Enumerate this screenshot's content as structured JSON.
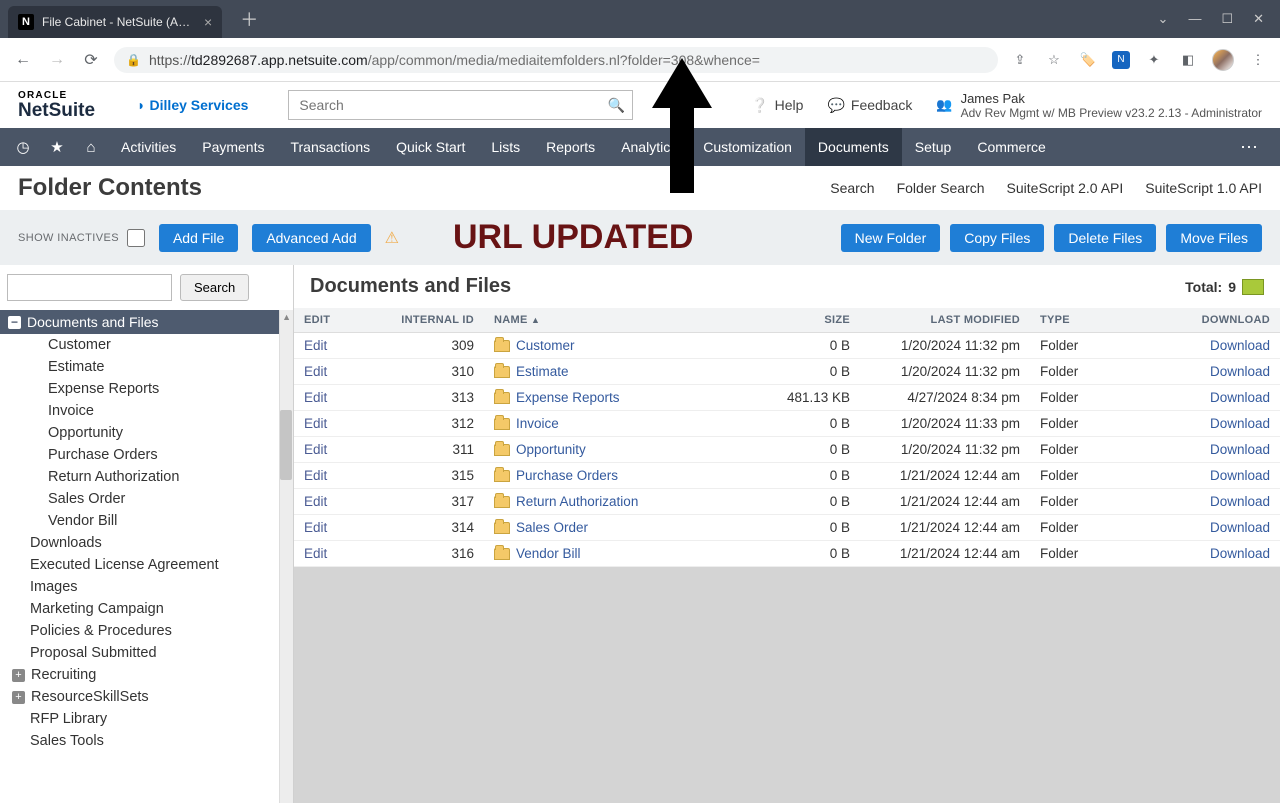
{
  "browser": {
    "tab_title": "File Cabinet - NetSuite (Adv Rev",
    "url_domain": "td2892687.app.netsuite.com",
    "url_path": "/app/common/media/mediaitemfolders.nl?folder=308&whence=",
    "url_prefix": "https://"
  },
  "topbar": {
    "brand_sub": "Dilley Services",
    "search_placeholder": "Search",
    "help": "Help",
    "feedback": "Feedback",
    "user_name": "James Pak",
    "user_role": "Adv Rev Mgmt w/ MB Preview v23.2 2.13  -  Administrator"
  },
  "nav": {
    "items": [
      "Activities",
      "Payments",
      "Transactions",
      "Quick Start",
      "Lists",
      "Reports",
      "Analytics",
      "Customization",
      "Documents",
      "Setup",
      "Commerce"
    ],
    "active": "Documents"
  },
  "page": {
    "title": "Folder Contents",
    "links": [
      "Search",
      "Folder Search",
      "SuiteScript 2.0 API",
      "SuiteScript 1.0 API"
    ]
  },
  "actions": {
    "show_inactives": "SHOW INACTIVES",
    "add_file": "Add File",
    "advanced_add": "Advanced Add",
    "url_updated": "URL UPDATED",
    "new_folder": "New Folder",
    "copy_files": "Copy Files",
    "delete_files": "Delete Files",
    "move_files": "Move Files"
  },
  "left": {
    "search_btn": "Search",
    "root": "Documents and Files",
    "children": [
      "Customer",
      "Estimate",
      "Expense Reports",
      "Invoice",
      "Opportunity",
      "Purchase Orders",
      "Return Authorization",
      "Sales Order",
      "Vendor Bill"
    ],
    "top_level": [
      {
        "label": "Downloads",
        "expand": false
      },
      {
        "label": "Executed License Agreement",
        "expand": false
      },
      {
        "label": "Images",
        "expand": false
      },
      {
        "label": "Marketing Campaign",
        "expand": false
      },
      {
        "label": "Policies & Procedures",
        "expand": false
      },
      {
        "label": "Proposal Submitted",
        "expand": false
      },
      {
        "label": "Recruiting",
        "expand": true
      },
      {
        "label": "ResourceSkillSets",
        "expand": true
      },
      {
        "label": "RFP Library",
        "expand": false
      },
      {
        "label": "Sales Tools",
        "expand": false
      }
    ]
  },
  "table": {
    "heading": "Documents and Files",
    "total_label": "Total:",
    "total_count": "9",
    "cols": {
      "edit": "EDIT",
      "id": "INTERNAL ID",
      "name": "NAME",
      "size": "SIZE",
      "modified": "LAST MODIFIED",
      "type": "TYPE",
      "download": "DOWNLOAD"
    },
    "edit_text": "Edit",
    "download_text": "Download",
    "rows": [
      {
        "id": "309",
        "name": "Customer",
        "size": "0 B",
        "modified": "1/20/2024 11:32 pm",
        "type": "Folder"
      },
      {
        "id": "310",
        "name": "Estimate",
        "size": "0 B",
        "modified": "1/20/2024 11:32 pm",
        "type": "Folder"
      },
      {
        "id": "313",
        "name": "Expense Reports",
        "size": "481.13 KB",
        "modified": "4/27/2024 8:34 pm",
        "type": "Folder"
      },
      {
        "id": "312",
        "name": "Invoice",
        "size": "0 B",
        "modified": "1/20/2024 11:33 pm",
        "type": "Folder"
      },
      {
        "id": "311",
        "name": "Opportunity",
        "size": "0 B",
        "modified": "1/20/2024 11:32 pm",
        "type": "Folder"
      },
      {
        "id": "315",
        "name": "Purchase Orders",
        "size": "0 B",
        "modified": "1/21/2024 12:44 am",
        "type": "Folder"
      },
      {
        "id": "317",
        "name": "Return Authorization",
        "size": "0 B",
        "modified": "1/21/2024 12:44 am",
        "type": "Folder"
      },
      {
        "id": "314",
        "name": "Sales Order",
        "size": "0 B",
        "modified": "1/21/2024 12:44 am",
        "type": "Folder"
      },
      {
        "id": "316",
        "name": "Vendor Bill",
        "size": "0 B",
        "modified": "1/21/2024 12:44 am",
        "type": "Folder"
      }
    ]
  }
}
